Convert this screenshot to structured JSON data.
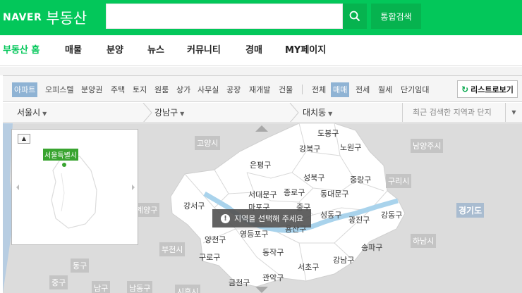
{
  "header": {
    "logo_brand": "NAVER",
    "logo_service": "부동산",
    "search_value": "",
    "search_button_icon": "search-icon",
    "total_search_label": "통합검색"
  },
  "mainnav": {
    "items": [
      "부동산 홈",
      "매물",
      "분양",
      "뉴스",
      "커뮤니티",
      "경매",
      "MY페이지"
    ]
  },
  "filters": {
    "types": [
      "아파트",
      "오피스텔",
      "분양권",
      "주택",
      "토지",
      "원룸",
      "상가",
      "사무실",
      "공장",
      "재개발",
      "건물"
    ],
    "deals": [
      "전체",
      "매매",
      "전세",
      "월세",
      "단기임대"
    ],
    "list_view_label": "리스트로보기"
  },
  "regions": {
    "city": "서울시",
    "district": "강남구",
    "dong": "대치동",
    "recent_label": "최근 검색한 지역과 단지"
  },
  "minimap": {
    "label": "서울특별시"
  },
  "toast": {
    "message": "지역을 선택해 주세요"
  },
  "map_labels": {
    "goyang": "고양시",
    "namyangju": "남양주시",
    "guri": "구리시",
    "gyeonggi": "경기도",
    "hanam": "하남시",
    "bucheon": "부천시",
    "gyeyang": "계양구",
    "donggu": "동구",
    "junggu": "중구",
    "namgu": "남구",
    "namdong": "남동구",
    "siheung": "시흥시",
    "dobong": "도봉구",
    "gangbuk": "강북구",
    "nowon": "노원구",
    "eunpyeong": "은평구",
    "seongbuk": "성북구",
    "jungnang": "중랑구",
    "seodaemun": "서대문구",
    "jongno": "종로구",
    "dongdaemun": "동대문구",
    "gangseo": "강서구",
    "mapo": "마포구",
    "jung": "중구",
    "seongdong": "성동구",
    "gwangjin": "광진구",
    "gangdong": "강동구",
    "yangcheon": "양천구",
    "yeongdeungpo": "영등포구",
    "yongsan": "용산구",
    "guro": "구로구",
    "dongjak": "동작구",
    "songpa": "송파구",
    "gangnam": "강남구",
    "seocho": "서초구",
    "gwanak": "관악구",
    "geumcheon": "금천구"
  }
}
